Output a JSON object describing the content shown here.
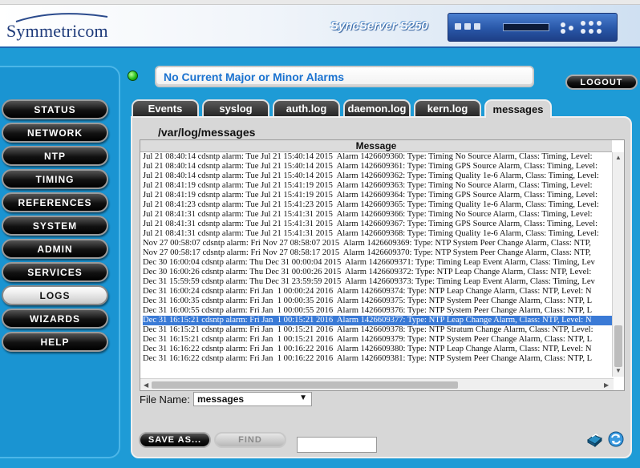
{
  "header": {
    "logo_text": "Symmetricom",
    "product_name": "SyncServer S250"
  },
  "alarm": {
    "status_text": "No Current Major or Minor Alarms"
  },
  "logout_label": "LOGOUT",
  "nav": {
    "items": [
      {
        "label": "STATUS"
      },
      {
        "label": "NETWORK"
      },
      {
        "label": "NTP"
      },
      {
        "label": "TIMING"
      },
      {
        "label": "REFERENCES"
      },
      {
        "label": "SYSTEM"
      },
      {
        "label": "ADMIN"
      },
      {
        "label": "SERVICES"
      },
      {
        "label": "LOGS",
        "active": true
      },
      {
        "label": "WIZARDS"
      },
      {
        "label": "HELP"
      }
    ]
  },
  "tabs": [
    {
      "label": "Events"
    },
    {
      "label": "syslog"
    },
    {
      "label": "auth.log"
    },
    {
      "label": "daemon.log"
    },
    {
      "label": "kern.log"
    },
    {
      "label": "messages",
      "active": true
    }
  ],
  "log": {
    "path": "/var/log/messages",
    "column_header": "Message",
    "lines": [
      "Jul 21 08:40:14 cdsntp alarm: Tue Jul 21 15:40:14 2015  Alarm 1426609360: Type: Timing No Source Alarm, Class: Timing, Level:",
      "Jul 21 08:40:14 cdsntp alarm: Tue Jul 21 15:40:14 2015  Alarm 1426609361: Type: Timing GPS Source Alarm, Class: Timing, Level:",
      "Jul 21 08:40:14 cdsntp alarm: Tue Jul 21 15:40:14 2015  Alarm 1426609362: Type: Timing Quality 1e-6 Alarm, Class: Timing, Level:",
      "Jul 21 08:41:19 cdsntp alarm: Tue Jul 21 15:41:19 2015  Alarm 1426609363: Type: Timing No Source Alarm, Class: Timing, Level:",
      "Jul 21 08:41:19 cdsntp alarm: Tue Jul 21 15:41:19 2015  Alarm 1426609364: Type: Timing GPS Source Alarm, Class: Timing, Level:",
      "Jul 21 08:41:23 cdsntp alarm: Tue Jul 21 15:41:23 2015  Alarm 1426609365: Type: Timing Quality 1e-6 Alarm, Class: Timing, Level:",
      "Jul 21 08:41:31 cdsntp alarm: Tue Jul 21 15:41:31 2015  Alarm 1426609366: Type: Timing No Source Alarm, Class: Timing, Level:",
      "Jul 21 08:41:31 cdsntp alarm: Tue Jul 21 15:41:31 2015  Alarm 1426609367: Type: Timing GPS Source Alarm, Class: Timing, Level:",
      "Jul 21 08:41:31 cdsntp alarm: Tue Jul 21 15:41:31 2015  Alarm 1426609368: Type: Timing Quality 1e-6 Alarm, Class: Timing, Level:",
      "Nov 27 00:58:07 cdsntp alarm: Fri Nov 27 08:58:07 2015  Alarm 1426609369: Type: NTP System Peer Change Alarm, Class: NTP,",
      "Nov 27 00:58:17 cdsntp alarm: Fri Nov 27 08:58:17 2015  Alarm 1426609370: Type: NTP System Peer Change Alarm, Class: NTP,",
      "Dec 30 16:00:04 cdsntp alarm: Thu Dec 31 00:00:04 2015  Alarm 1426609371: Type: Timing Leap Event Alarm, Class: Timing, Lev",
      "Dec 30 16:00:26 cdsntp alarm: Thu Dec 31 00:00:26 2015  Alarm 1426609372: Type: NTP Leap Change Alarm, Class: NTP, Level:",
      "Dec 31 15:59:59 cdsntp alarm: Thu Dec 31 23:59:59 2015  Alarm 1426609373: Type: Timing Leap Event Alarm, Class: Timing, Lev",
      "Dec 31 16:00:24 cdsntp alarm: Fri Jan  1 00:00:24 2016  Alarm 1426609374: Type: NTP Leap Change Alarm, Class: NTP, Level: N",
      "Dec 31 16:00:35 cdsntp alarm: Fri Jan  1 00:00:35 2016  Alarm 1426609375: Type: NTP System Peer Change Alarm, Class: NTP, L",
      "Dec 31 16:00:55 cdsntp alarm: Fri Jan  1 00:00:55 2016  Alarm 1426609376: Type: NTP System Peer Change Alarm, Class: NTP, L",
      "Dec 31 16:15:21 cdsntp alarm: Fri Jan  1 00:15:21 2016  Alarm 1426609377: Type: NTP Leap Change Alarm, Class: NTP, Level: N",
      "Dec 31 16:15:21 cdsntp alarm: Fri Jan  1 00:15:21 2016  Alarm 1426609378: Type: NTP Stratum Change Alarm, Class: NTP, Level:",
      "Dec 31 16:15:21 cdsntp alarm: Fri Jan  1 00:15:21 2016  Alarm 1426609379: Type: NTP System Peer Change Alarm, Class: NTP, L",
      "Dec 31 16:16:22 cdsntp alarm: Fri Jan  1 00:16:22 2016  Alarm 1426609380: Type: NTP Leap Change Alarm, Class: NTP, Level: N",
      "Dec 31 16:16:22 cdsntp alarm: Fri Jan  1 00:16:22 2016  Alarm 1426609381: Type: NTP System Peer Change Alarm, Class: NTP, L"
    ],
    "selected_index": 17
  },
  "file_name": {
    "label": "File Name:",
    "selected": "messages"
  },
  "buttons": {
    "save_as": "SAVE AS...",
    "find": "FIND"
  },
  "find_input": {
    "value": ""
  },
  "colors": {
    "background": "#1e9bd6",
    "alarm_text": "#1a72d0",
    "selection": "#3a7ad6"
  }
}
